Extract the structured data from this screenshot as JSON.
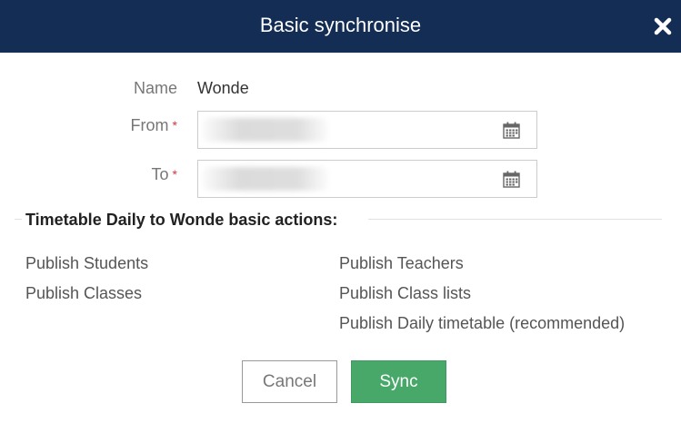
{
  "dialog": {
    "title": "Basic synchronise",
    "close_icon": "close-x-icon"
  },
  "form": {
    "name_label": "Name",
    "name_value": "Wonde",
    "from_label": "From",
    "to_label": "To",
    "required_marker": "*",
    "from_value": "",
    "to_value": "",
    "calendar_icon": "calendar-icon"
  },
  "section": {
    "title": "Timetable Daily to Wonde basic actions:",
    "actions_left": [
      "Publish Students",
      "Publish Classes"
    ],
    "actions_right": [
      "Publish Teachers",
      "Publish Class lists",
      "Publish Daily timetable (recommended)"
    ]
  },
  "buttons": {
    "cancel": "Cancel",
    "sync": "Sync"
  },
  "colors": {
    "header_bg": "#142d55",
    "sync_bg": "#47a869",
    "required": "#d9363e"
  }
}
